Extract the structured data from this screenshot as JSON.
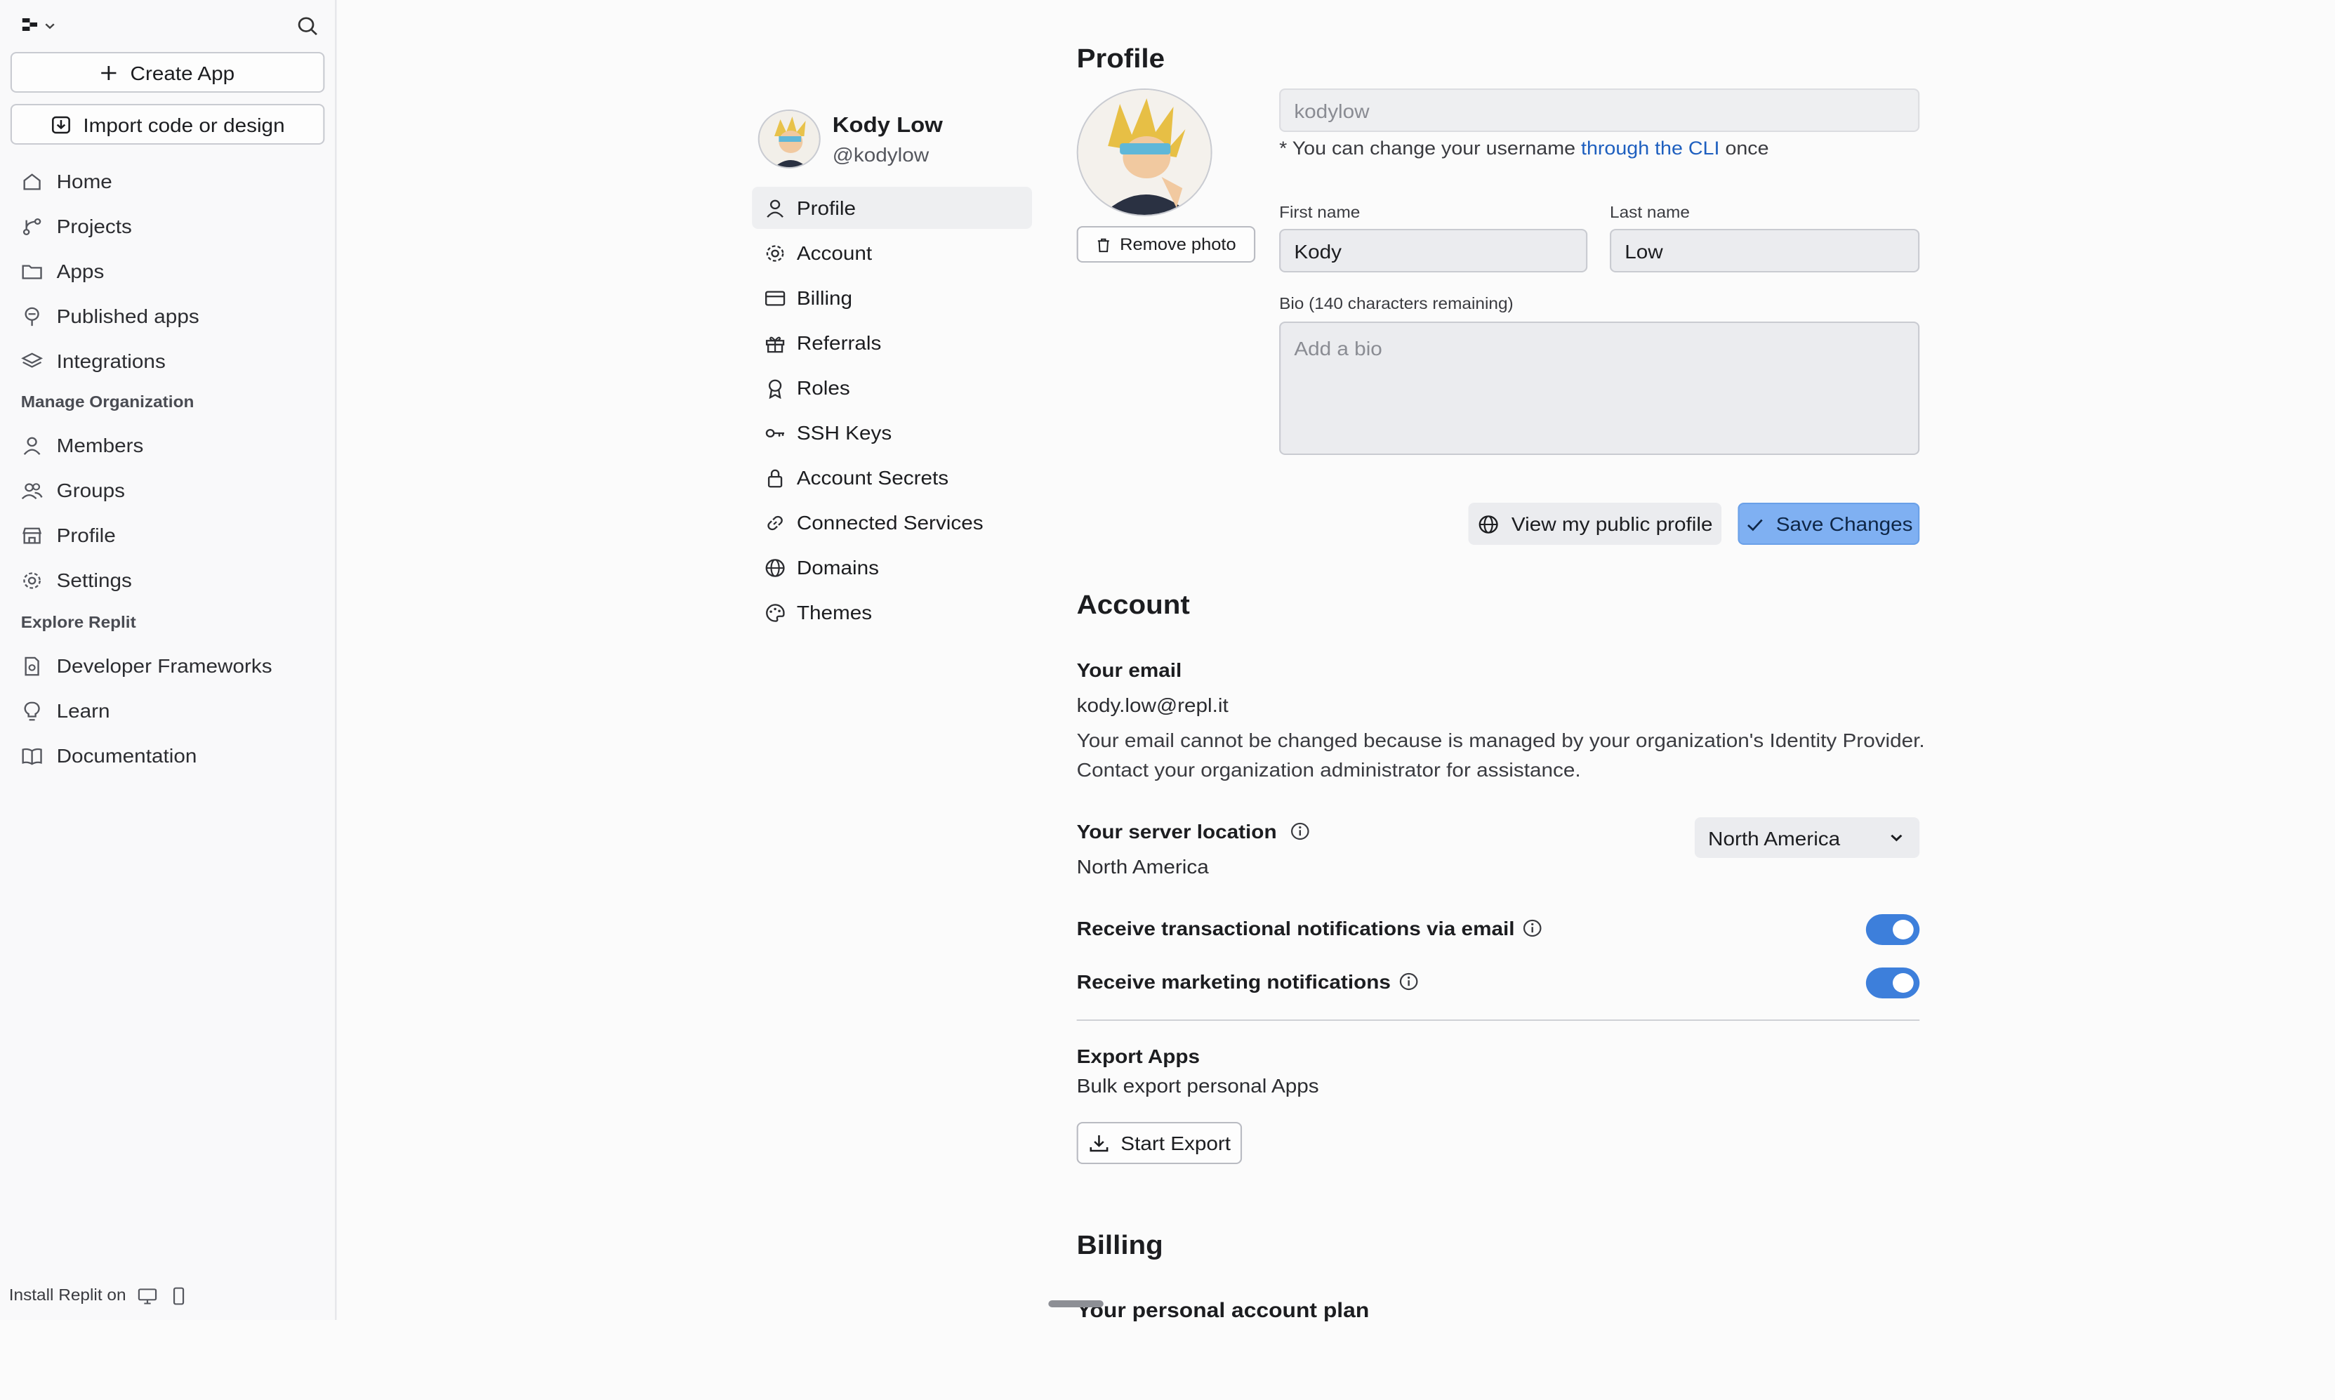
{
  "sidebar": {
    "create_app": "Create App",
    "import": "Import code or design",
    "nav": [
      {
        "label": "Home",
        "icon": "home-icon"
      },
      {
        "label": "Projects",
        "icon": "projects-icon"
      },
      {
        "label": "Apps",
        "icon": "folder-icon"
      },
      {
        "label": "Published apps",
        "icon": "published-icon"
      },
      {
        "label": "Integrations",
        "icon": "layers-icon"
      }
    ],
    "manage_org_title": "Manage Organization",
    "manage_org": [
      {
        "label": "Members",
        "icon": "user-icon"
      },
      {
        "label": "Groups",
        "icon": "users-icon"
      },
      {
        "label": "Profile",
        "icon": "store-icon"
      },
      {
        "label": "Settings",
        "icon": "gear-icon"
      }
    ],
    "explore_title": "Explore Replit",
    "explore": [
      {
        "label": "Developer Frameworks",
        "icon": "framework-icon"
      },
      {
        "label": "Learn",
        "icon": "bulb-icon"
      },
      {
        "label": "Documentation",
        "icon": "book-icon"
      }
    ],
    "install_label": "Install Replit on"
  },
  "user": {
    "name": "Kody Low",
    "handle": "@kodylow"
  },
  "settings_nav": [
    {
      "label": "Profile",
      "icon": "user-icon"
    },
    {
      "label": "Account",
      "icon": "gear-icon"
    },
    {
      "label": "Billing",
      "icon": "card-icon"
    },
    {
      "label": "Referrals",
      "icon": "gift-icon"
    },
    {
      "label": "Roles",
      "icon": "badge-icon"
    },
    {
      "label": "SSH Keys",
      "icon": "key-icon"
    },
    {
      "label": "Account Secrets",
      "icon": "lock-icon"
    },
    {
      "label": "Connected Services",
      "icon": "link-icon"
    },
    {
      "label": "Domains",
      "icon": "globe-icon"
    },
    {
      "label": "Themes",
      "icon": "palette-icon"
    }
  ],
  "profile": {
    "title": "Profile",
    "remove_photo": "Remove photo",
    "username_value": "kodylow",
    "hint_prefix": "* You can change your username",
    "hint_link": "through the CLI",
    "hint_suffix": "once",
    "first_name_label": "First name",
    "first_name": "Kody",
    "last_name_label": "Last name",
    "last_name": "Low",
    "bio_label": "Bio (140 characters remaining)",
    "bio_placeholder": "Add a bio",
    "view_public": "View my public profile",
    "save": "Save Changes"
  },
  "account": {
    "title": "Account",
    "email_title": "Your email",
    "email": "kody.low@repl.it",
    "email_note": "Your email cannot be changed because is managed by your organization's Identity Provider. Contact your organization administrator for assistance.",
    "server_title": "Your server location",
    "server_value": "North America",
    "server_select": "North America",
    "transactional": "Receive transactional notifications via email",
    "transactional_on": true,
    "marketing": "Receive marketing notifications",
    "marketing_on": true,
    "export_title": "Export Apps",
    "export_desc": "Bulk export personal Apps",
    "start_export": "Start Export"
  },
  "billing": {
    "title": "Billing",
    "plan_title": "Your personal account plan"
  },
  "colors": {
    "accent": "#3d7fdb",
    "save_button": "#7fb0f2",
    "link": "#1e5fbf"
  }
}
